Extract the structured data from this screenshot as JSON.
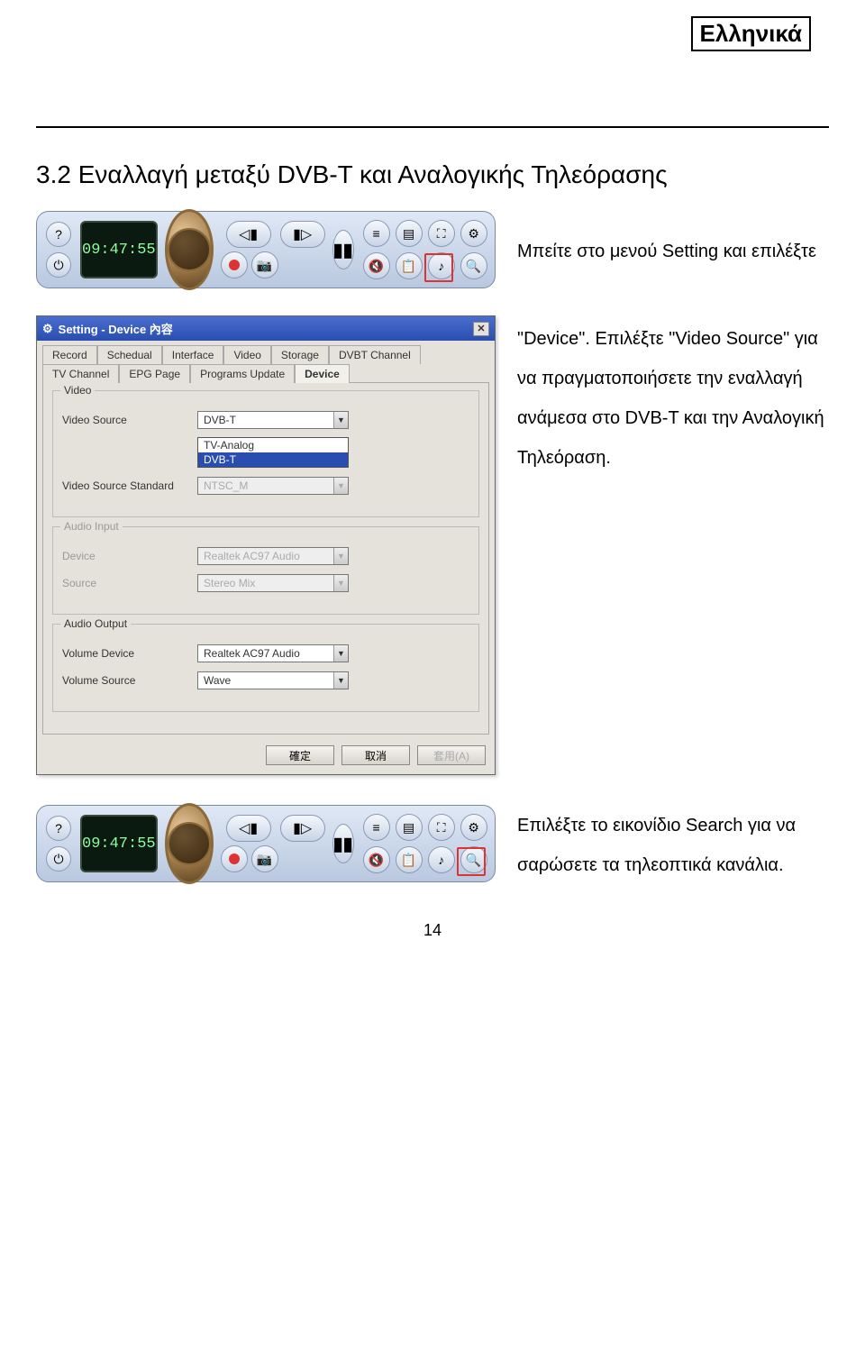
{
  "header": {
    "language_label": "Ελληνικά"
  },
  "section": {
    "title": "3.2 Εναλλαγή μεταξύ DVB-T και Αναλογικής Τηλεόρασης",
    "para1": "Μπείτε στο μενού Setting και επιλέξτε \"Device\". Επιλέξτε \"Video Source\" για να πραγματοποιήσετε την εναλλαγή ανάμεσα στο DVB-T και την Αναλογική Τηλεόραση.",
    "para2": "Επιλέξτε το εικονίδιο Search για να σαρώσετε τα τηλεοπτικά κανάλια."
  },
  "player": {
    "time": "09:47:55"
  },
  "dialog": {
    "title": "Setting - Device 內容",
    "tabs": {
      "record": "Record",
      "schedual": "Schedual",
      "interface": "Interface",
      "video": "Video",
      "storage": "Storage",
      "dvbt_channel": "DVBT Channel",
      "tv_channel": "TV Channel",
      "epg_page": "EPG Page",
      "programs_update": "Programs Update",
      "device": "Device"
    },
    "groups": {
      "video": {
        "label": "Video",
        "video_source_label": "Video Source",
        "video_source_value": "DVB-T",
        "options": {
          "tv_analog": "TV-Analog",
          "dvbt": "DVB-T"
        },
        "vss_label": "Video Source Standard",
        "vss_value": "NTSC_M"
      },
      "audio_input": {
        "label": "Audio Input",
        "device_label": "Device",
        "device_value": "Realtek AC97 Audio",
        "source_label": "Source",
        "source_value": "Stereo Mix"
      },
      "audio_output": {
        "label": "Audio Output",
        "volume_device_label": "Volume Device",
        "volume_device_value": "Realtek AC97 Audio",
        "volume_source_label": "Volume Source",
        "volume_source_value": "Wave"
      }
    },
    "buttons": {
      "ok": "確定",
      "cancel": "取消",
      "apply": "套用(A)"
    }
  },
  "page_number": "14"
}
